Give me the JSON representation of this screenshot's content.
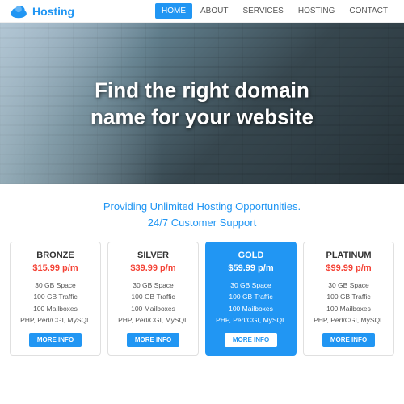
{
  "header": {
    "logo_text": "Hosting",
    "nav_items": [
      {
        "label": "HOME",
        "active": true
      },
      {
        "label": "ABOUT",
        "active": false
      },
      {
        "label": "SERVICES",
        "active": false
      },
      {
        "label": "HOSTING",
        "active": false
      },
      {
        "label": "CONTACT",
        "active": false
      }
    ]
  },
  "hero": {
    "title_line1": "Find the right domain",
    "title_line2": "name for your website"
  },
  "subtitle": {
    "line1": "Providing Unlimited Hosting Opportunities.",
    "line2": "24/7 Customer Support"
  },
  "plans": [
    {
      "name": "BRONZE",
      "price": "$15.99 p/m",
      "features": [
        "30 GB Space",
        "100 GB Traffic",
        "100 Mailboxes",
        "PHP, Perl/CGI, MySQL"
      ],
      "highlighted": false,
      "btn_label": "MORE INFO"
    },
    {
      "name": "SILVER",
      "price": "$39.99 p/m",
      "features": [
        "30 GB Space",
        "100 GB Traffic",
        "100 Mailboxes",
        "PHP, Perl/CGI, MySQL"
      ],
      "highlighted": false,
      "btn_label": "MORE INFO"
    },
    {
      "name": "GOLD",
      "price": "$59.99 p/m",
      "features": [
        "30 GB Space",
        "100 GB Traffic",
        "100 Mailboxes",
        "PHP, Perl/CGI, MySQL"
      ],
      "highlighted": true,
      "btn_label": "MORE INFO"
    },
    {
      "name": "PLATINUM",
      "price": "$99.99 p/m",
      "features": [
        "30 GB Space",
        "100 GB Traffic",
        "100 Mailboxes",
        "PHP, Perl/CGI, MySQL"
      ],
      "highlighted": false,
      "btn_label": "MORE INFO"
    }
  ]
}
